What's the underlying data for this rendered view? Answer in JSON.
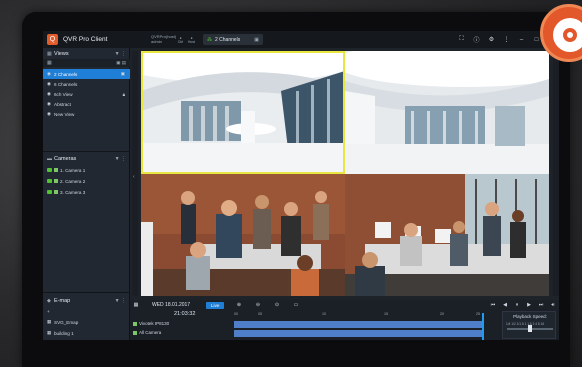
{
  "app": {
    "title": "QVR Pro Client",
    "logo_glyph": "Q"
  },
  "titlebar": {
    "user_line1": "QVRPro(host)",
    "user_line2": "admin",
    "mini_a": "Ctrl",
    "mini_b": "Host",
    "channels_label": "2 Channels",
    "icons": [
      "fullscreen-icon",
      "info-icon",
      "gear-icon",
      "more-icon"
    ]
  },
  "views": {
    "header": "Views",
    "items": [
      {
        "label": "2 Channels",
        "selected": true
      },
      {
        "label": "6 Channels",
        "selected": false
      },
      {
        "label": "6ch View",
        "selected": false
      },
      {
        "label": "Abstract",
        "selected": false
      },
      {
        "label": "New View",
        "selected": false
      }
    ]
  },
  "cameras": {
    "header": "Cameras",
    "items": [
      {
        "label": "1. Camera 1"
      },
      {
        "label": "2. Camera 2"
      },
      {
        "label": "3. Camera 3"
      }
    ]
  },
  "emap": {
    "header": "E-map",
    "add": "+",
    "items": [
      {
        "label": "SVG_Emap"
      },
      {
        "label": "building 1"
      }
    ]
  },
  "timeline": {
    "date": "WED 18.01.2017",
    "live_label": "Live",
    "current_time": "21:03:32",
    "ticks": [
      "00",
      "05",
      "10",
      "15",
      "20",
      "25"
    ],
    "tracks": [
      {
        "label": "Vivotek IP8130"
      },
      {
        "label": "All Camera"
      }
    ],
    "playback_speed_label": "Playback Speed:",
    "speed_marks": "1/4 1/2 1/1.5  1  1.5  2  4  8  16"
  },
  "colors": {
    "accent": "#1f7ed6",
    "selected_tile": "#e8e640",
    "brand": "#e2582a",
    "camera_status": "#52c234",
    "recording_track": "#4f7fc9"
  }
}
